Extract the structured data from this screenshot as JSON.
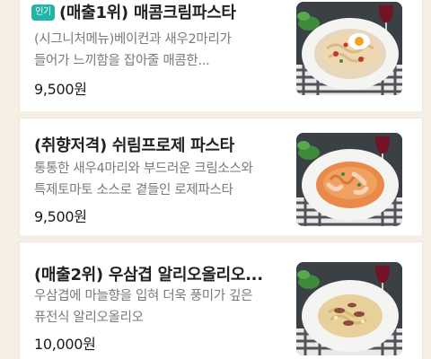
{
  "menu": {
    "items": [
      {
        "badge": "인기",
        "title": "(매출1위) 매콤크림파스타",
        "description_line1": "(시그니처메뉴)베이컨과 새우2마리가",
        "description_line2": "들어가 느끼함을 잡아줄 매콤한...",
        "price": "9,500원",
        "image": "spicy-cream-pasta-photo"
      },
      {
        "title": "(취향저격) 쉬림프로제 파스타",
        "description_line1": "통통한 새우4마리와 부드러운 크림소스와",
        "description_line2": "특제토마토 소스로 곁들인 로제파스타",
        "price": "9,500원",
        "image": "shrimp-rose-pasta-photo"
      },
      {
        "title": "(매출2위) 우삼겹 알리오올리오...",
        "description_line1": "우삼겹에 마늘향을 입혀 더욱 풍미가 깊은",
        "description_line2": "퓨전식 알리오올리오",
        "price": "10,000원",
        "image": "beef-aglio-olio-photo"
      }
    ]
  }
}
